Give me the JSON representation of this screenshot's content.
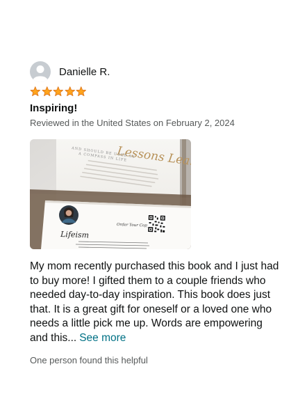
{
  "review": {
    "reviewer_name": "Danielle R.",
    "rating": 5,
    "rating_max": 5,
    "title": "Inspiring!",
    "meta": "Reviewed in the United States on February 2, 2024",
    "body": "My mom recently purchased this book and I just had to buy more! I gifted them to a couple friends who needed day-to-day inspiration. This book does just that. It is a great gift for oneself or a loved one who needs a little pick me up. Words are empowering and this...",
    "see_more_label": "See more",
    "helpful_text": "One person found this helpful"
  },
  "photo": {
    "cover_script": "Lessons Learned",
    "cover_subtitle": "AND SHOULD BE USED AS A COMPASS IN LIFE",
    "card_script": "Lifeism",
    "card_order": "Order Your Copy",
    "card_caption": "A universal phrase that helps the reader move forward or deal with a situation based on an experience that teaches a lesson."
  },
  "colors": {
    "star": "#ffa41c",
    "star_border": "#de7921",
    "link": "#007185",
    "secondary_text": "#565959",
    "primary_text": "#0f1111"
  },
  "icons": {
    "avatar": "person-avatar-icon",
    "star": "star-icon"
  }
}
